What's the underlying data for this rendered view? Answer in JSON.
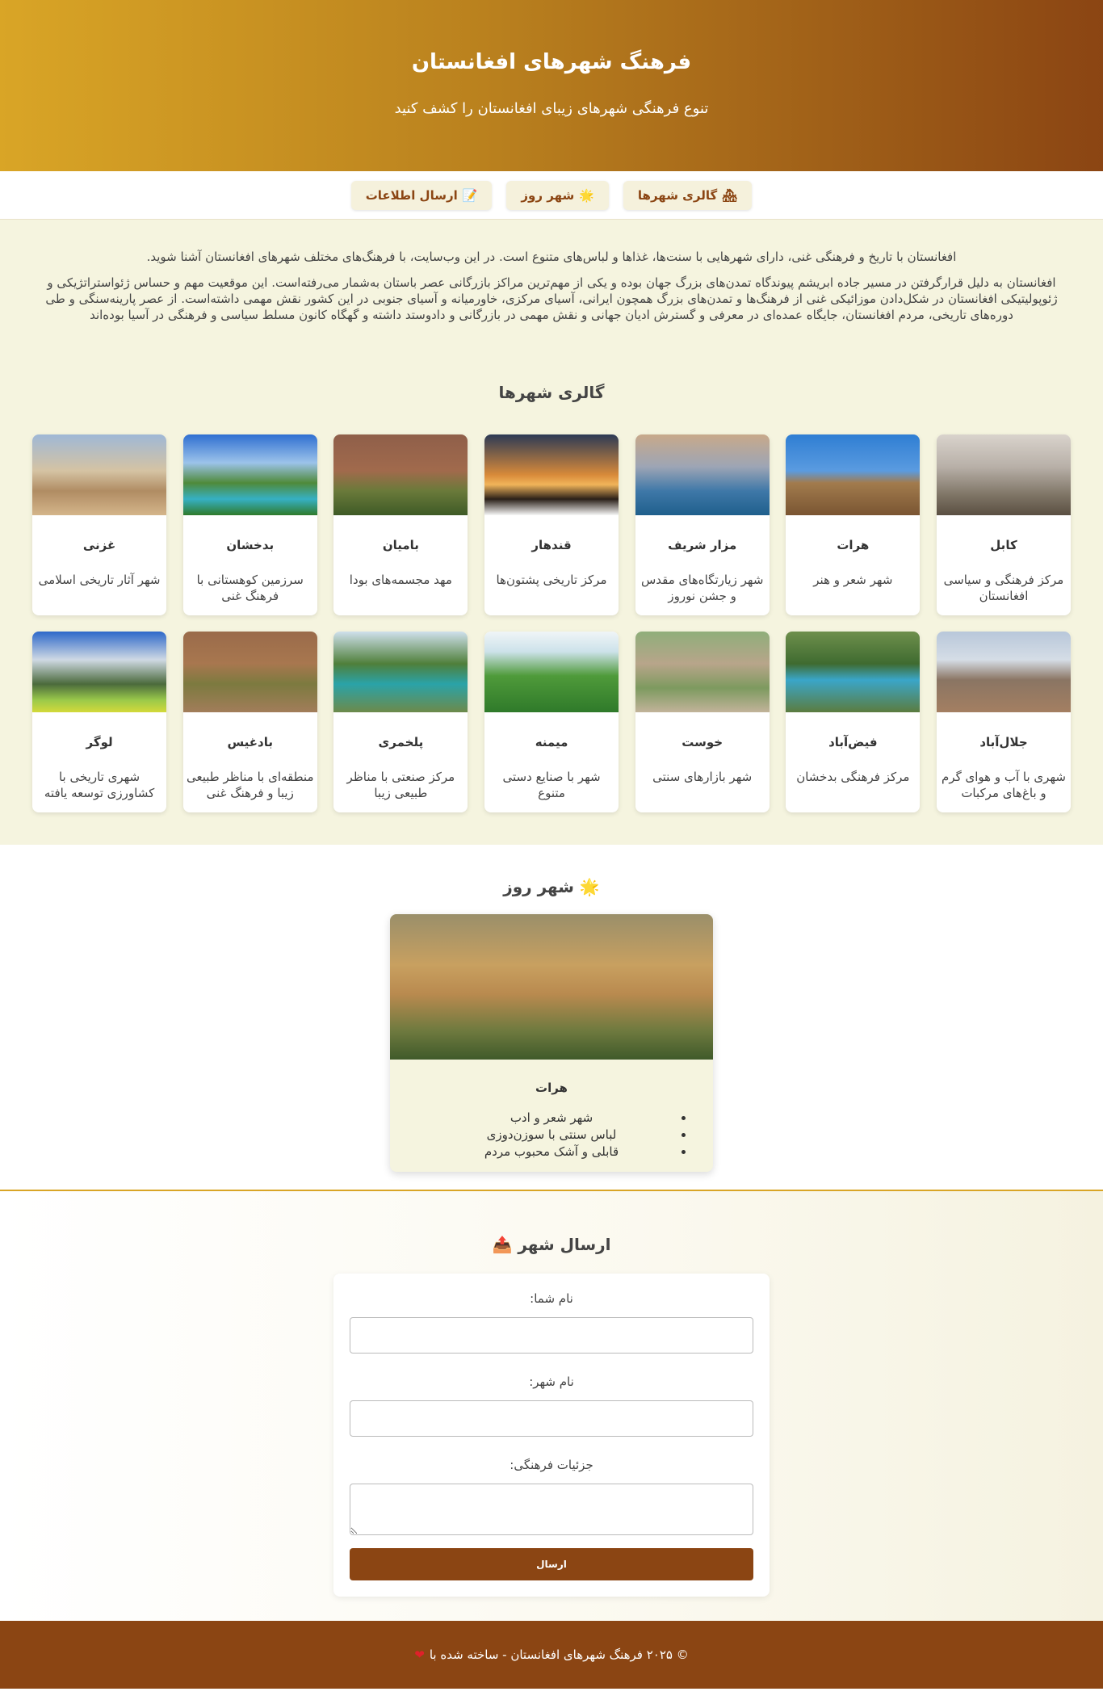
{
  "hero": {
    "title": "فرهنگ شهرهای افغانستان",
    "subtitle": "تنوع فرهنگی شهرهای زیبای افغانستان را کشف کنید"
  },
  "nav": [
    {
      "label": "گالری شهرها",
      "icon": "🏘"
    },
    {
      "label": "شهر روز",
      "icon": "🌟"
    },
    {
      "label": "ارسال اطلاعات",
      "icon": "📝"
    }
  ],
  "intro": {
    "lead": "افغانستان با تاریخ و فرهنگی غنی، دارای شهرهایی با سنت‌ها، غذاها و لباس‌های متنوع است. در این وب‌سایت، با فرهنگ‌های مختلف شهرهای افغانستان آشنا شوید.",
    "body": "افغانستان به دلیل قرارگرفتن در مسیر جاده ابریشم پیوندگاه تمدن‌های بزرگ جهان بوده و یکی از مهم‌ترین مراکز بازرگانی عصر باستان به‌شمار می‌رفته‌است. این موقعیت مهم و حساس ژئواستراتژیکی و ژئوپولیتیکی افغانستان در شکل‌دادن موزائیکی غنی از فرهنگ‌ها و تمدن‌های بزرگ همچون ایرانی، آسیای مرکزی، خاورمیانه و آسیای جنوبی در این کشور نقش مهمی داشته‌است. از عصر پارینه‌سنگی و طی دوره‌های تاریخی، مردم افغانستان، جایگاه عمده‌ای در معرفی و گسترش ادیان جهانی و نقش مهمی در بازرگانی و دادوستد داشته و گهگاه کانون مسلط سیاسی و فرهنگی در آسیا بوده‌اند"
  },
  "gallery": {
    "title": "گالری شهرها",
    "cities": [
      {
        "name": "کابل",
        "desc": "مرکز فرهنگی و سیاسی افغانستان",
        "img": "img-kabul"
      },
      {
        "name": "هرات",
        "desc": "شهر شعر و هنر",
        "img": "img-herat"
      },
      {
        "name": "مزار شریف",
        "desc": "شهر زیارتگاه‌های مقدس و جشن نوروز",
        "img": "img-mazar"
      },
      {
        "name": "قندهار",
        "desc": "مرکز تاریخی پشتون‌ها",
        "img": "img-kandahar"
      },
      {
        "name": "بامیان",
        "desc": "مهد مجسمه‌های بودا",
        "img": "img-bamyan"
      },
      {
        "name": "بدخشان",
        "desc": "سرزمین کوهستانی با فرهنگ غنی",
        "img": "img-badakhshan"
      },
      {
        "name": "غزنی",
        "desc": "شهر آثار تاریخی اسلامی",
        "img": "img-ghazni"
      },
      {
        "name": "جلال‌آباد",
        "desc": "شهری با آب و هوای گرم و باغ‌های مرکبات",
        "img": "img-jalalabad"
      },
      {
        "name": "فیض‌آباد",
        "desc": "مرکز فرهنگی بدخشان",
        "img": "img-faizabad"
      },
      {
        "name": "خوست",
        "desc": "شهر بازارهای سنتی",
        "img": "img-khost"
      },
      {
        "name": "میمنه",
        "desc": "شهر با صنایع دستی متنوع",
        "img": "img-maimana"
      },
      {
        "name": "پلخمری",
        "desc": "مرکز صنعتی با مناظر طبیعی زیبا",
        "img": "img-pulekhumri"
      },
      {
        "name": "بادغیس",
        "desc": "منطقه‌ای با مناظر طبیعی زیبا و فرهنگ غنی",
        "img": "img-badghis"
      },
      {
        "name": "لوگر",
        "desc": "شهری تاریخی با کشاورزی توسعه یافته",
        "img": "img-logar"
      }
    ]
  },
  "daily": {
    "title": "شهر روز",
    "icon": "🌟",
    "city": "هرات",
    "points": [
      "شهر شعر و ادب",
      "لباس سنتی با سوزن‌دوزی",
      "قابلی و آشک محبوب مردم"
    ]
  },
  "submit": {
    "title": "ارسال شهر",
    "icon": "📤",
    "name_label": "نام شما:",
    "city_label": "نام شهر:",
    "details_label": "جزئیات فرهنگی:",
    "button": "ارسال"
  },
  "footer": {
    "text": "© ۲۰۲۵ فرهنگ شهرهای افغانستان - ساخته شده با",
    "heart": "❤"
  }
}
